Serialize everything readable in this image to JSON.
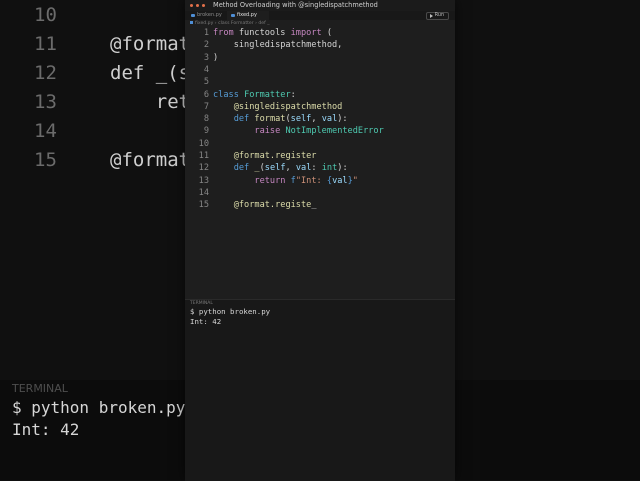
{
  "background": {
    "lines": [
      {
        "num": "10",
        "code": ""
      },
      {
        "num": "11",
        "code": "@format"
      },
      {
        "num": "12",
        "code": "def _(s"
      },
      {
        "num": "13",
        "code": "    ret"
      },
      {
        "num": "14",
        "code": ""
      },
      {
        "num": "15",
        "code": "@format"
      }
    ],
    "terminal_title": "TERMINAL",
    "terminal_lines": [
      "$ python broken.py",
      "Int: 42"
    ]
  },
  "window": {
    "title": "Method Overloading with @singledispatchmethod",
    "tabs": [
      {
        "label": "broken.py",
        "active": false
      },
      {
        "label": "fixed.py",
        "active": true
      }
    ],
    "run_label": "Run",
    "breadcrumb": "fixed.py › class Formatter › def _"
  },
  "editor": {
    "lines": [
      {
        "num": "1",
        "parts": [
          [
            "kw",
            "from"
          ],
          [
            "",
            " functools "
          ],
          [
            "kw",
            "import"
          ],
          [
            "",
            " ("
          ]
        ]
      },
      {
        "num": "2",
        "parts": [
          [
            "",
            "    singledispatchmethod,"
          ]
        ]
      },
      {
        "num": "3",
        "parts": [
          [
            "",
            ")"
          ]
        ]
      },
      {
        "num": "4",
        "parts": []
      },
      {
        "num": "5",
        "parts": []
      },
      {
        "num": "6",
        "parts": [
          [
            "kw2",
            "class"
          ],
          [
            "",
            " "
          ],
          [
            "cls",
            "Formatter"
          ],
          [
            "",
            ":"
          ]
        ]
      },
      {
        "num": "7",
        "parts": [
          [
            "",
            "    "
          ],
          [
            "dec",
            "@singledispatchmethod"
          ]
        ]
      },
      {
        "num": "8",
        "parts": [
          [
            "",
            "    "
          ],
          [
            "kw2",
            "def"
          ],
          [
            "",
            " "
          ],
          [
            "fn",
            "format"
          ],
          [
            "",
            "("
          ],
          [
            "param",
            "self"
          ],
          [
            "",
            ", "
          ],
          [
            "param",
            "val"
          ],
          [
            "",
            "):"
          ]
        ]
      },
      {
        "num": "9",
        "parts": [
          [
            "",
            "        "
          ],
          [
            "kw",
            "raise"
          ],
          [
            "",
            " "
          ],
          [
            "cls",
            "NotImplementedError"
          ]
        ]
      },
      {
        "num": "10",
        "parts": []
      },
      {
        "num": "11",
        "parts": [
          [
            "",
            "    "
          ],
          [
            "dec",
            "@format.register"
          ]
        ]
      },
      {
        "num": "12",
        "parts": [
          [
            "",
            "    "
          ],
          [
            "kw2",
            "def"
          ],
          [
            "",
            " "
          ],
          [
            "fn",
            "_"
          ],
          [
            "",
            "("
          ],
          [
            "param",
            "self"
          ],
          [
            "",
            ", "
          ],
          [
            "param",
            "val"
          ],
          [
            "",
            ": "
          ],
          [
            "cls",
            "int"
          ],
          [
            "",
            "):"
          ]
        ]
      },
      {
        "num": "13",
        "parts": [
          [
            "",
            "        "
          ],
          [
            "kw",
            "return"
          ],
          [
            "",
            " "
          ],
          [
            "kw2",
            "f"
          ],
          [
            "str",
            "\"Int: "
          ],
          [
            "kw2",
            "{"
          ],
          [
            "param",
            "val"
          ],
          [
            "kw2",
            "}"
          ],
          [
            "str",
            "\""
          ]
        ]
      },
      {
        "num": "14",
        "parts": []
      },
      {
        "num": "15",
        "parts": [
          [
            "",
            "    "
          ],
          [
            "dec",
            "@format.registe"
          ],
          [
            "",
            "_"
          ]
        ]
      }
    ]
  },
  "terminal": {
    "title": "TERMINAL",
    "lines": [
      "$ python broken.py",
      "Int: 42"
    ]
  }
}
